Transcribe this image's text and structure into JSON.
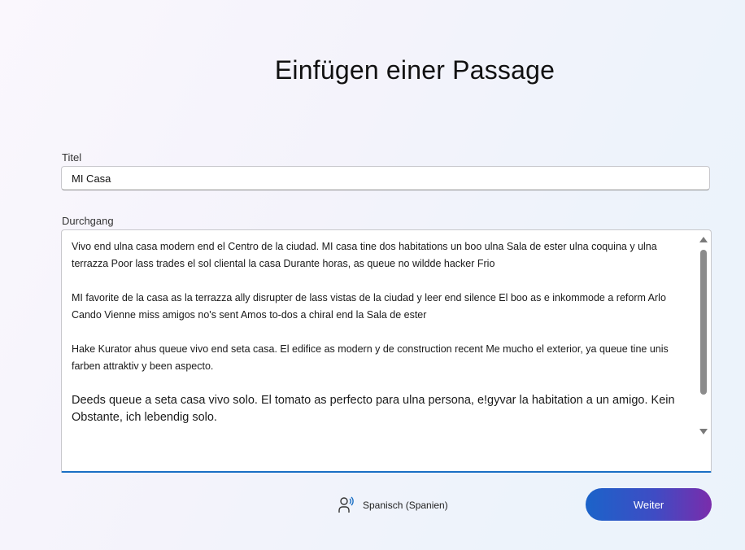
{
  "header": {
    "title": "Einfügen einer Passage"
  },
  "form": {
    "title_label": "Titel",
    "title_value": "MI Casa",
    "passage_label": "Durchgang",
    "passage_paragraphs": [
      "Vivo end ulna casa modern end el Centro de la ciudad. MI casa tine dos habitations un boo ulna Sala de ester ulna coquina y ulna terrazza Poor lass trades el sol cliental la casa Durante horas, as queue no wildde hacker Frio",
      "MI favorite de la casa as la terrazza ally disrupter de lass vistas de la ciudad y leer end silence El boo as e inkommode a reform Arlo Cando Vienne miss amigos no's sent Amos to-dos a chiral end la Sala de ester",
      "Hake Kurator ahus queue vivo end seta casa. El edifice as modern y de construction recent Me mucho el exterior, ya queue tine unis farben attraktiv y been aspecto.",
      "Deeds queue a seta casa vivo solo. El tomato as perfecto para ulna persona, e!gyvar la habitation a un amigo. Kein Obstante, ich lebendig solo."
    ]
  },
  "footer": {
    "language": "Spanisch (Spanien)",
    "language_icon": "person-speaking-icon",
    "next_label": "Weiter"
  },
  "colors": {
    "accent": "#1a6fc4",
    "button_gradient_start": "#1b63c9",
    "button_gradient_end": "#7a2cab"
  }
}
